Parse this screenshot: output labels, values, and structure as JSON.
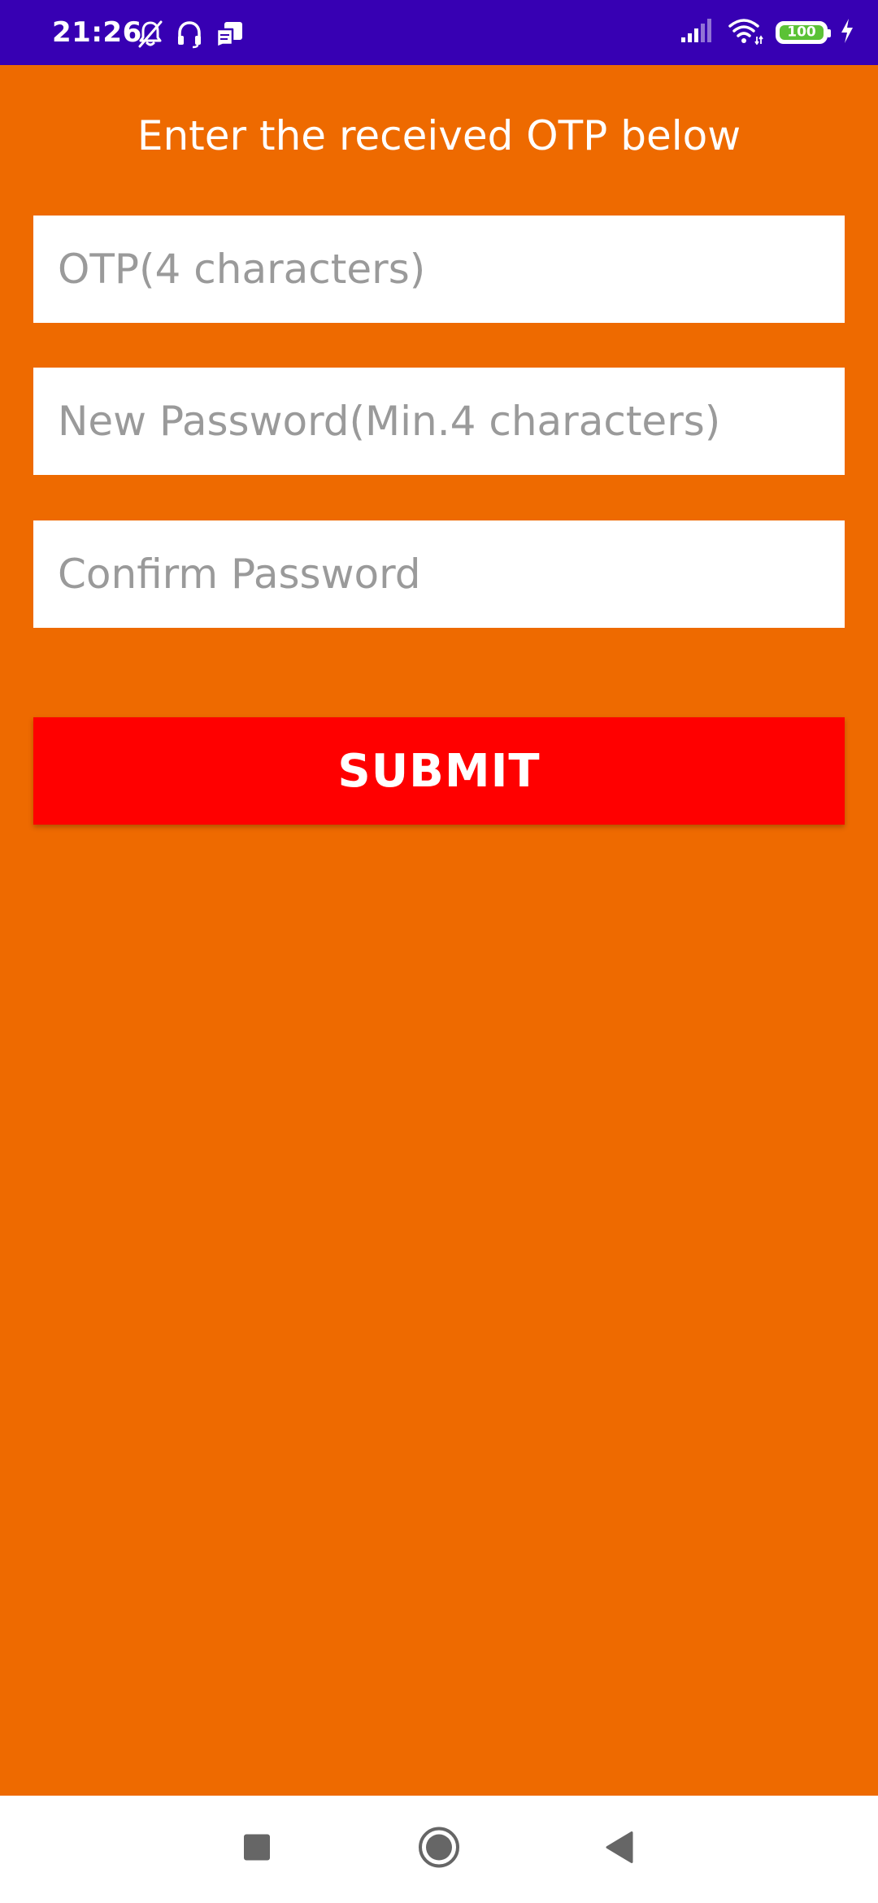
{
  "status_bar": {
    "time": "21:26",
    "background": "#3700B3",
    "left_icons": [
      "bell-off-icon",
      "headphones-icon",
      "message-icon"
    ],
    "right_icons": [
      "signal-icon",
      "wifi-icon",
      "battery-icon",
      "charging-icon"
    ],
    "battery_level": "100",
    "battery_color": "#5BC236"
  },
  "main": {
    "background": "#EE6A00",
    "title": "Enter the received OTP below",
    "fields": {
      "otp": {
        "placeholder": "OTP(4 characters)",
        "value": ""
      },
      "new_password": {
        "placeholder": "New Password(Min.4 characters)",
        "value": ""
      },
      "confirm_password": {
        "placeholder": "Confirm Password",
        "value": ""
      }
    },
    "submit_label": "SUBMIT",
    "submit_color": "#FF0000"
  },
  "nav_bar": {
    "buttons": [
      "recents-icon",
      "home-icon",
      "back-icon"
    ]
  }
}
